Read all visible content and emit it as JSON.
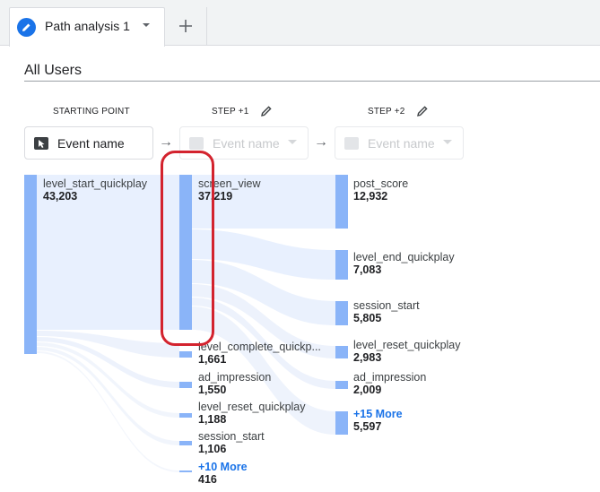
{
  "tabs": {
    "active_label": "Path analysis 1",
    "add_label": "+"
  },
  "segment": "All Users",
  "columns": [
    {
      "header": "STARTING POINT",
      "dimension": "Event name",
      "enabled": true
    },
    {
      "header": "STEP +1",
      "dimension": "Event name",
      "enabled": false
    },
    {
      "header": "STEP +2",
      "dimension": "Event name",
      "enabled": false
    }
  ],
  "starting_point": {
    "name": "level_start_quickplay",
    "value": "43,203"
  },
  "step1": [
    {
      "name": "screen_view",
      "value": "37,219"
    },
    {
      "name": "level_complete_quickp...",
      "value": "1,661"
    },
    {
      "name": "ad_impression",
      "value": "1,550"
    },
    {
      "name": "level_reset_quickplay",
      "value": "1,188"
    },
    {
      "name": "session_start",
      "value": "1,106"
    },
    {
      "more": "+10 More",
      "value": "416"
    }
  ],
  "step2": [
    {
      "name": "post_score",
      "value": "12,932"
    },
    {
      "name": "level_end_quickplay",
      "value": "7,083"
    },
    {
      "name": "session_start",
      "value": "5,805"
    },
    {
      "name": "level_reset_quickplay",
      "value": "2,983"
    },
    {
      "name": "ad_impression",
      "value": "2,009"
    },
    {
      "more": "+15 More",
      "value": "5,597"
    }
  ],
  "colors": {
    "node_bar": "#8ab4f8",
    "flow": "#e8f0fe",
    "highlight": "#d3232e",
    "accent": "#1a73e8"
  },
  "icons": [
    "edit-pencil-icon",
    "chevron-down-icon",
    "plus-icon",
    "cursor-icon",
    "arrow-right-icon"
  ]
}
